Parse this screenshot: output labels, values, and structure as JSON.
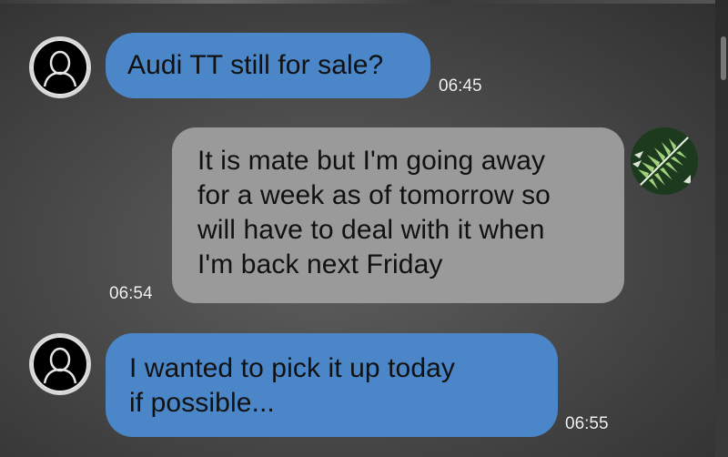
{
  "conversation": {
    "messages": [
      {
        "sender": "incoming",
        "lines": [
          "Audi TT still for sale?"
        ],
        "time": "06:45"
      },
      {
        "sender": "outgoing",
        "lines": [
          "It is mate but I'm going away",
          "for a week as of tomorrow so",
          "will have to deal with it when",
          "I'm back next Friday"
        ],
        "time": "06:54"
      },
      {
        "sender": "incoming",
        "lines": [
          "I wanted to pick it up today",
          "if possible..."
        ],
        "time": "06:55"
      }
    ]
  },
  "avatars": {
    "incoming": "person-silhouette-icon",
    "outgoing": "fern-leaf-icon"
  },
  "colors": {
    "background": "#4a4a4a",
    "incoming_bubble": "#4a86c8",
    "outgoing_bubble": "#9a9a9a",
    "text": "#111111",
    "timestamp": "#f2f2f2"
  }
}
